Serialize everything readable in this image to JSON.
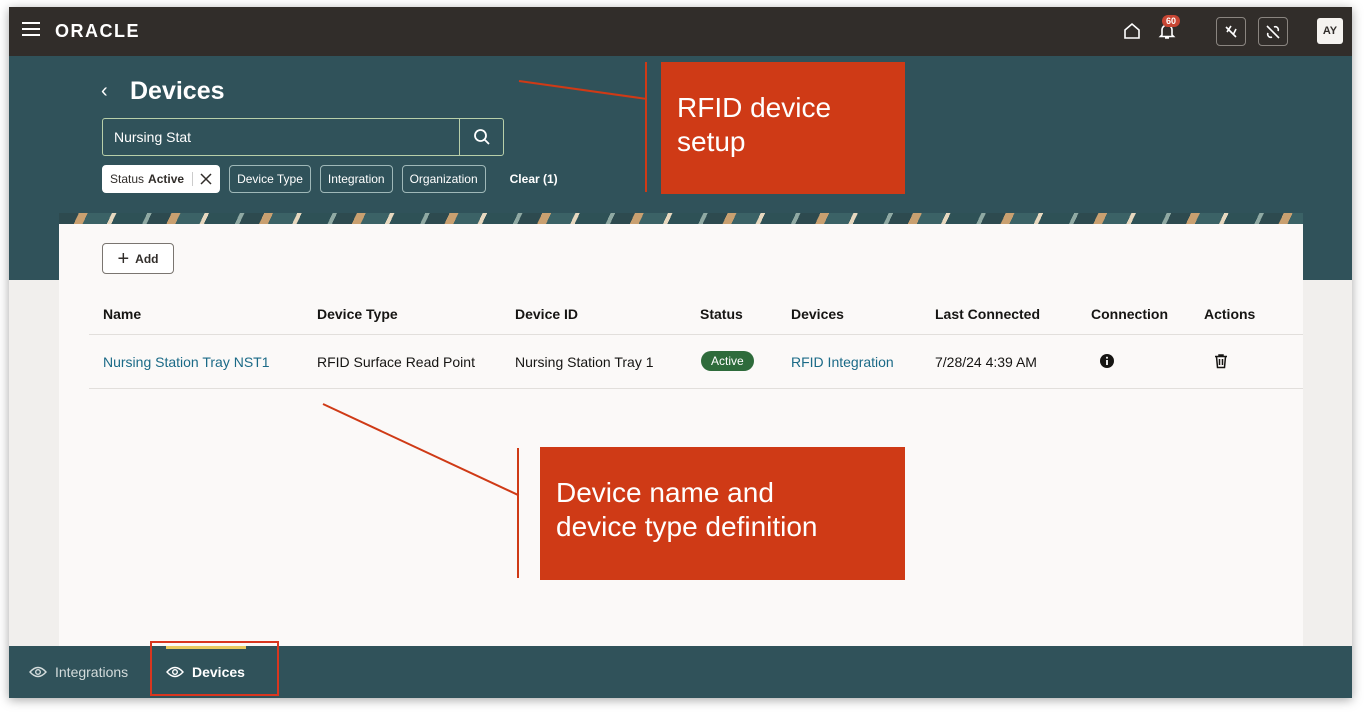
{
  "brand": {
    "name": "ORACLE"
  },
  "topbar": {
    "notification_count": "60",
    "avatar_initials": "AY"
  },
  "header": {
    "title": "Devices",
    "search_value": "Nursing Stat"
  },
  "filters": {
    "status_label": "Status",
    "status_value": "Active",
    "chips": [
      "Device Type",
      "Integration",
      "Organization"
    ],
    "clear_label": "Clear (1)"
  },
  "toolbar": {
    "add_label": "Add"
  },
  "table": {
    "columns": [
      "Name",
      "Device Type",
      "Device ID",
      "Status",
      "Devices",
      "Last Connected",
      "Connection",
      "Actions"
    ],
    "rows": [
      {
        "name": "Nursing Station Tray NST1",
        "device_type": "RFID Surface Read Point",
        "device_id": "Nursing Station Tray 1",
        "status": "Active",
        "devices": "RFID Integration",
        "last_connected": "7/28/24 4:39 AM"
      }
    ]
  },
  "bottom_nav": {
    "items": [
      "Integrations",
      "Devices"
    ],
    "active": "Devices"
  },
  "callouts": {
    "top_line1": "RFID device",
    "top_line2": "setup",
    "bottom_line1": "Device name and",
    "bottom_line2": "device type definition"
  },
  "colors": {
    "accent_orange": "#cf3a16",
    "header_teal": "#30525a",
    "topbar": "#312d2a",
    "active_green": "#2e6b3b"
  }
}
